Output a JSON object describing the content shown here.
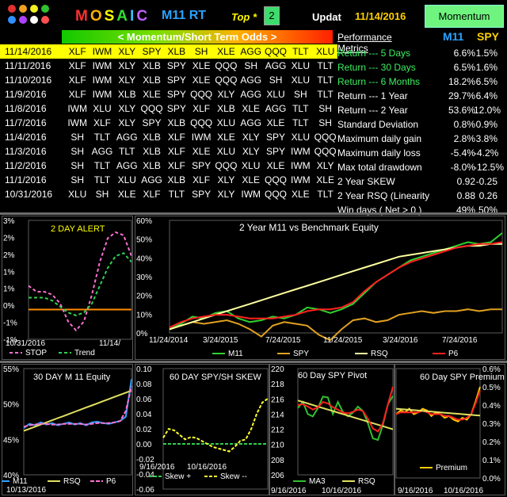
{
  "header": {
    "brand": "MOSAIC",
    "brand_colors": [
      "#ff3030",
      "#ffb000",
      "#ffff00",
      "#30e030",
      "#30c0ff",
      "#c060ff"
    ],
    "model": "M11 RT",
    "top_label": "Top *",
    "top_value": "2",
    "updat_label": "Updat",
    "date": "11/14/2016",
    "mode": "Momentum",
    "logo_dots": [
      "#e03030",
      "#f0a020",
      "#f0f020",
      "#30c030",
      "#3090ff",
      "#b040ff",
      "#ffffff",
      "#ff5050",
      "#50d0ff"
    ]
  },
  "odds_bar": "< Momentum/Short Term Odds >",
  "rankings": {
    "rows": [
      {
        "date": "11/14/2016",
        "picks": [
          "XLF",
          "IWM",
          "XLY",
          "SPY",
          "XLB",
          "SH",
          "XLE",
          "AGG",
          "QQQ",
          "TLT",
          "XLU"
        ]
      },
      {
        "date": "11/11/2016",
        "picks": [
          "XLF",
          "IWM",
          "XLY",
          "XLB",
          "SPY",
          "XLE",
          "QQQ",
          "SH",
          "AGG",
          "XLU",
          "TLT"
        ]
      },
      {
        "date": "11/10/2016",
        "picks": [
          "XLF",
          "IWM",
          "XLY",
          "XLB",
          "SPY",
          "XLE",
          "QQQ",
          "AGG",
          "SH",
          "XLU",
          "TLT"
        ]
      },
      {
        "date": "11/9/2016",
        "picks": [
          "XLF",
          "IWM",
          "XLB",
          "XLE",
          "SPY",
          "QQQ",
          "XLY",
          "AGG",
          "XLU",
          "SH",
          "TLT"
        ]
      },
      {
        "date": "11/8/2016",
        "picks": [
          "IWM",
          "XLU",
          "XLY",
          "QQQ",
          "SPY",
          "XLF",
          "XLB",
          "XLE",
          "AGG",
          "TLT",
          "SH"
        ]
      },
      {
        "date": "11/7/2016",
        "picks": [
          "IWM",
          "XLF",
          "XLY",
          "SPY",
          "XLB",
          "QQQ",
          "XLU",
          "AGG",
          "XLE",
          "TLT",
          "SH"
        ]
      },
      {
        "date": "11/4/2016",
        "picks": [
          "SH",
          "TLT",
          "AGG",
          "XLB",
          "XLF",
          "IWM",
          "XLE",
          "XLY",
          "SPY",
          "XLU",
          "QQQ"
        ]
      },
      {
        "date": "11/3/2016",
        "picks": [
          "SH",
          "AGG",
          "TLT",
          "XLB",
          "XLF",
          "XLE",
          "XLU",
          "XLY",
          "SPY",
          "IWM",
          "QQQ"
        ]
      },
      {
        "date": "11/2/2016",
        "picks": [
          "SH",
          "TLT",
          "AGG",
          "XLB",
          "XLF",
          "SPY",
          "QQQ",
          "XLU",
          "XLE",
          "IWM",
          "XLY"
        ]
      },
      {
        "date": "11/1/2016",
        "picks": [
          "SH",
          "TLT",
          "XLU",
          "AGG",
          "XLB",
          "XLF",
          "XLY",
          "XLE",
          "QQQ",
          "IWM",
          "XLE"
        ]
      },
      {
        "date": "10/31/2016",
        "picks": [
          "XLU",
          "SH",
          "XLE",
          "XLF",
          "TLT",
          "SPY",
          "XLY",
          "IWM",
          "QQQ",
          "XLE",
          "TLT"
        ]
      }
    ]
  },
  "performance": {
    "title": "Performance Metrics",
    "col1": "M11",
    "col2": "SPY",
    "rows": [
      {
        "label": "Return --- 5 Days",
        "m11": "6.6%",
        "spy": "1.5%",
        "green": true
      },
      {
        "label": "Return --- 30 Days",
        "m11": "6.5%",
        "spy": "1.6%",
        "green": true
      },
      {
        "label": "Return --- 6 Months",
        "m11": "18.2%",
        "spy": "6.5%",
        "green": true
      },
      {
        "label": "Return --- 1 Year",
        "m11": "29.7%",
        "spy": "6.4%",
        "green": false
      },
      {
        "label": "Return --- 2 Year",
        "m11": "53.6%",
        "spy": "12.0%",
        "green": false
      },
      {
        "label": "Standard Deviation",
        "m11": "0.8%",
        "spy": "0.9%",
        "green": false
      },
      {
        "label": "Maximum daily gain",
        "m11": "2.8%",
        "spy": "3.8%",
        "green": false
      },
      {
        "label": "Maximum daily loss",
        "m11": "-5.4%",
        "spy": "-4.2%",
        "green": false
      },
      {
        "label": "Max total drawdown",
        "m11": "-8.0%",
        "spy": "-12.5%",
        "green": false
      },
      {
        "label": "2 Year SKEW",
        "m11": "0.92",
        "spy": "-0.25",
        "green": false
      },
      {
        "label": "2 Year RSQ  (Linearity",
        "m11": "0.88",
        "spy": "0.26",
        "green": false
      },
      {
        "label": "Win days ( Net > 0 )",
        "m11": "49%",
        "spy": "50%",
        "green": false
      }
    ]
  },
  "chart_data": [
    {
      "type": "line",
      "title": "2 DAY  ALERT",
      "y_ticks": [
        "3%",
        "2%",
        "2%",
        "1%",
        "1%",
        "0%",
        "-1%",
        "-1%"
      ],
      "x_ticks": [
        "10/31/2016",
        "11/14/"
      ],
      "series": [
        {
          "name": "STOP",
          "color": "#ff70d0",
          "values": [
            0.8,
            0.6,
            0.6,
            0.5,
            0.2,
            -0.4,
            -0.7,
            -0.4,
            0.5,
            1.6,
            2.4,
            2.6,
            2.5,
            1.8
          ]
        },
        {
          "name": "Trend",
          "color": "#30d050",
          "values": [
            0.4,
            0.4,
            0.4,
            0.3,
            0.1,
            -0.1,
            -0.2,
            -0.1,
            0.2,
            0.8,
            1.4,
            1.8,
            1.9,
            1.6
          ]
        }
      ],
      "reference": {
        "color": "#ff8c00",
        "value": 0.0
      }
    },
    {
      "type": "line",
      "title": "2 Year M11 vs Benchmark Equity",
      "y_ticks": [
        "60%",
        "50%",
        "40%",
        "30%",
        "20%",
        "10%",
        "0%"
      ],
      "x_ticks": [
        "11/24/2014",
        "3/24/2015",
        "7/24/2015",
        "11/24/2015",
        "3/24/2016",
        "7/24/2016"
      ],
      "series": [
        {
          "name": "M11",
          "color": "#30d030",
          "values": [
            0,
            3,
            7,
            6,
            9,
            10,
            6,
            4,
            5,
            7,
            6,
            8,
            12,
            11,
            9,
            11,
            14,
            20,
            26,
            30,
            34,
            38,
            40,
            42,
            44,
            46,
            48,
            47,
            48,
            53
          ]
        },
        {
          "name": "SPY",
          "color": "#e0a020",
          "values": [
            0,
            2,
            4,
            3,
            4,
            5,
            3,
            0,
            -4,
            2,
            4,
            3,
            2,
            -3,
            -6,
            0,
            5,
            6,
            4,
            5,
            8,
            9,
            10,
            9,
            10,
            10,
            11,
            10,
            11,
            11
          ]
        },
        {
          "name": "RSQ",
          "color": "#ffffa0",
          "values": [
            0,
            2,
            4,
            6,
            8,
            10,
            12,
            14,
            16,
            18,
            20,
            22,
            24,
            26,
            28,
            30,
            32,
            34,
            36,
            38,
            40,
            41,
            42,
            43,
            44,
            45,
            46,
            46,
            47,
            47
          ]
        },
        {
          "name": "P6",
          "color": "#ff2020",
          "values": [
            1,
            4,
            6,
            7,
            8,
            8,
            7,
            6,
            6,
            6,
            7,
            8,
            10,
            11,
            11,
            12,
            15,
            21,
            26,
            30,
            34,
            37,
            39,
            41,
            43,
            45,
            46,
            47,
            47,
            48
          ]
        }
      ]
    },
    {
      "type": "line",
      "title": "30 DAY  M 11   Equity",
      "y_ticks": [
        "55%",
        "50%",
        "45%",
        "40%"
      ],
      "x_ticks": [
        "10/13/2016"
      ],
      "series": [
        {
          "name": "M11",
          "color": "#30a0ff",
          "values": [
            46.6,
            47.2,
            47.0,
            47.4,
            47.1,
            47.3,
            47.0,
            47.2,
            47.4,
            47.1,
            47.3,
            47.0,
            47.4,
            47.5,
            47.3,
            47.2,
            47.4,
            47.6,
            48.2,
            53.5
          ]
        },
        {
          "name": "RSQ",
          "color": "#e0e060",
          "values": [
            46.2,
            46.5,
            46.8,
            47.1,
            47.4,
            47.7,
            48.0,
            48.3,
            48.6,
            48.9,
            49.2,
            49.5,
            49.8,
            50.1,
            50.4,
            50.7,
            51.0,
            51.3,
            51.6,
            51.9
          ]
        },
        {
          "name": "P6",
          "color": "#ff70d0",
          "values": [
            46.8,
            47.0,
            47.1,
            47.2,
            47.2,
            47.1,
            47.1,
            47.2,
            47.2,
            47.2,
            47.2,
            47.1,
            47.2,
            47.3,
            47.3,
            47.3,
            47.4,
            47.6,
            49.0,
            52.5
          ]
        }
      ]
    },
    {
      "type": "line",
      "title": "60  DAY  SPY/SH  SKEW",
      "y_ticks": [
        "0.10",
        "0.08",
        "0.06",
        "0.04",
        "0.02",
        "0.00",
        "-0.02",
        "-0.04",
        "-0.06"
      ],
      "x_ticks": [
        "9/16/2016",
        "10/16/2016"
      ],
      "series": [
        {
          "name": "Skew +",
          "color": "#30d050",
          "values": [
            0,
            0,
            0,
            0,
            0,
            0,
            0,
            0,
            0,
            0,
            0,
            0,
            0,
            0,
            0,
            0,
            0,
            0,
            0,
            0
          ]
        },
        {
          "name": "Skew --",
          "color": "#ffff30",
          "values": [
            0.008,
            0.02,
            0.018,
            0.012,
            0.006,
            0.009,
            0.008,
            0.004,
            0.0,
            -0.004,
            -0.006,
            -0.008,
            -0.01,
            -0.004,
            0.004,
            0.006,
            0.02,
            0.04,
            0.055,
            0.06
          ]
        }
      ]
    },
    {
      "type": "line",
      "title": "60  Day  SPY  Pivot",
      "y_ticks": [
        "220",
        "218",
        "216",
        "214",
        "212",
        "210",
        "208",
        "206"
      ],
      "x_ticks": [
        "9/16/2016",
        "10/16/2016"
      ],
      "series": [
        {
          "name": "MA3",
          "color": "#30c030",
          "values": [
            214.8,
            215.6,
            214.0,
            213.7,
            214.8,
            216.3,
            216.2,
            214.0,
            215.6,
            214.3,
            213.7,
            214.2,
            215.0,
            214.4,
            212.8,
            210.8,
            210.6,
            212.6,
            215.3,
            216.4
          ]
        },
        {
          "name": "RSQ",
          "color": "#e0e060",
          "values": [
            215.8,
            215.6,
            215.4,
            215.2,
            215.0,
            214.8,
            214.6,
            214.4,
            214.2,
            214.0,
            213.8,
            213.6,
            213.4,
            213.2,
            213.0,
            212.8,
            212.6,
            212.4,
            212.2,
            212.0
          ]
        },
        {
          "name": "Pivot",
          "color": "#ff2020",
          "values": [
            215.2,
            215.3,
            215.0,
            214.6,
            214.9,
            215.6,
            215.4,
            214.9,
            214.6,
            214.2,
            214.1,
            214.3,
            214.6,
            214.4,
            213.4,
            212.1,
            211.7,
            212.8,
            215.3,
            217.6
          ]
        }
      ]
    },
    {
      "type": "line",
      "title": "60  Day  SPY  Premium",
      "y_ticks": [
        "0.6%",
        "0.5%",
        "0.4%",
        "0.3%",
        "0.2%",
        "0.1%",
        "0.0%"
      ],
      "x_ticks": [
        "9/16/2016",
        "10/16/2016"
      ],
      "series": [
        {
          "name": "Premium",
          "color": "#ffcc00",
          "values": [
            0.35,
            0.37,
            0.36,
            0.38,
            0.35,
            0.36,
            0.38,
            0.37,
            0.34,
            0.36,
            0.35,
            0.33,
            0.34,
            0.32,
            0.31,
            0.33,
            0.32,
            0.35,
            0.42,
            0.5
          ]
        },
        {
          "name": "Trend",
          "color": "#ff2020",
          "values": [
            0.35,
            0.36,
            0.36,
            0.36,
            0.36,
            0.36,
            0.37,
            0.36,
            0.35,
            0.35,
            0.35,
            0.34,
            0.34,
            0.33,
            0.32,
            0.32,
            0.33,
            0.35,
            0.41,
            0.48
          ]
        },
        {
          "name": "Regression",
          "color": "#e0e060",
          "values": [
            0.38,
            0.378,
            0.376,
            0.374,
            0.372,
            0.37,
            0.368,
            0.366,
            0.364,
            0.362,
            0.36,
            0.358,
            0.356,
            0.354,
            0.352,
            0.35,
            0.348,
            0.346,
            0.344,
            0.342
          ]
        }
      ]
    }
  ]
}
